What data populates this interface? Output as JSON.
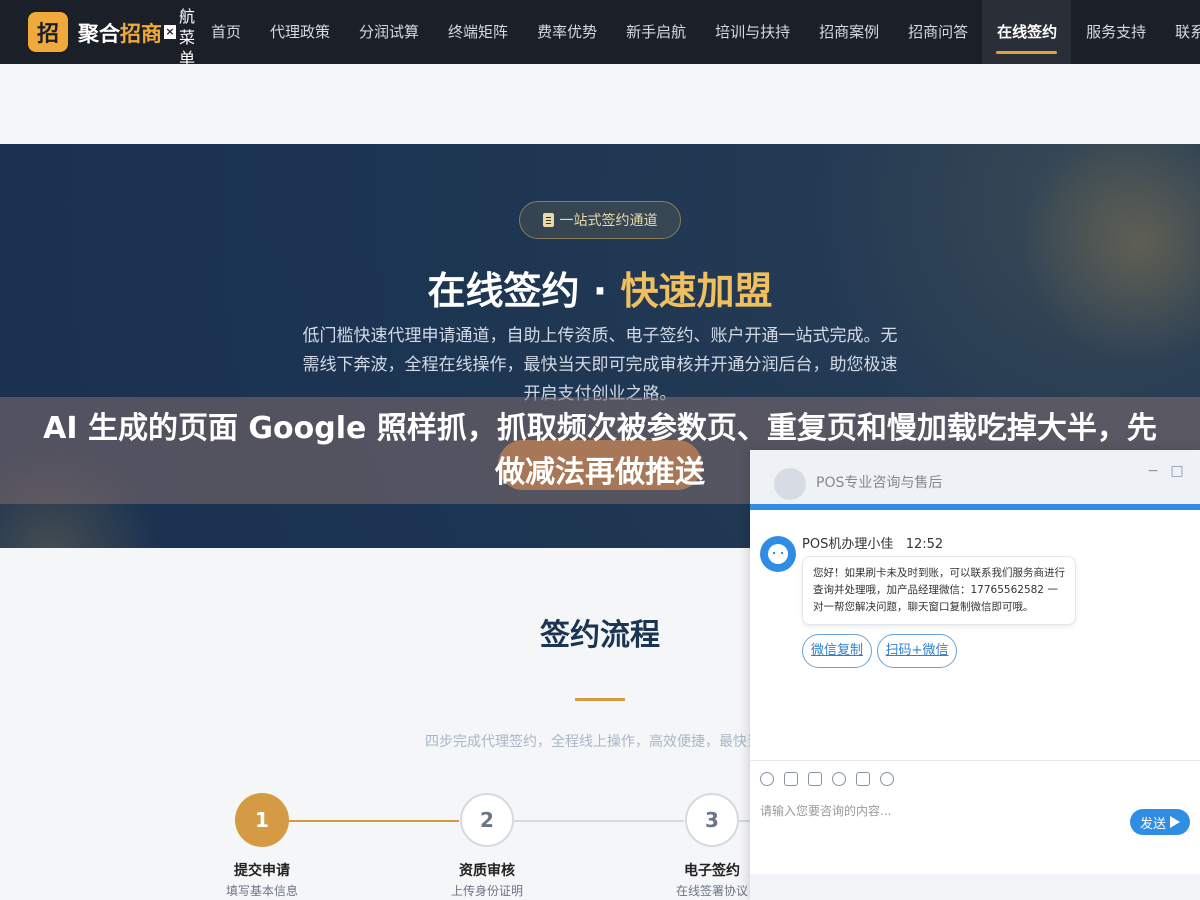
{
  "nav": {
    "logo_char": "招",
    "brand_part1": "聚合",
    "brand_part2": "招商",
    "close_char": "×",
    "vertical_menu": [
      "航",
      "菜",
      "单"
    ],
    "links": [
      "首页",
      "代理政策",
      "分润试算",
      "终端矩阵",
      "费率优势",
      "新手启航",
      "培训与扶持",
      "招商案例",
      "招商问答",
      "在线签约",
      "服务支持",
      "联系"
    ],
    "active_index": 9
  },
  "hero": {
    "badge": "一站式签约通道",
    "title_main": "在线签约 · ",
    "title_accent": "快速加盟",
    "desc": "低门槛快速代理申请通道，自助上传资质、电子签约、账户开通一站式完成。无需线下奔波，全程在线操作，最快当天即可完成审核并开通分润后台，助您极速开启支付创业之路。"
  },
  "overlay": {
    "text": "AI 生成的页面 Google 照样抓，抓取频次被参数页、重复页和慢加载吃掉大半，先做减法再做推送"
  },
  "process": {
    "title": "签约流程",
    "subtitle": "四步完成代理签约，全程线上操作，高效便捷，最快当天",
    "steps": [
      {
        "num": "1",
        "name": "提交申请",
        "desc": "填写基本信息",
        "done": true
      },
      {
        "num": "2",
        "name": "资质审核",
        "desc": "上传身份证明",
        "done": false
      },
      {
        "num": "3",
        "name": "电子签约",
        "desc": "在线签署协议",
        "done": false
      }
    ],
    "colors": {
      "done": "#d49b44",
      "todo": "#d5dae2"
    }
  },
  "chat": {
    "title": "POS专业咨询与售后",
    "minimize": "−",
    "maximize": "□",
    "agent_name": "POS机办理小佳",
    "time": "12:52",
    "message": "您好！如果刷卡未及时到账，可以联系我们服务商进行查询并处理哦，加产品经理微信：17765562582 一对一帮您解决问题，聊天窗口复制微信即可哦。",
    "chips": [
      "微信复制",
      "扫码+微信"
    ],
    "input_placeholder": "请输入您要咨询的内容...",
    "send_label": "发送",
    "accent": "#2f8de4"
  }
}
